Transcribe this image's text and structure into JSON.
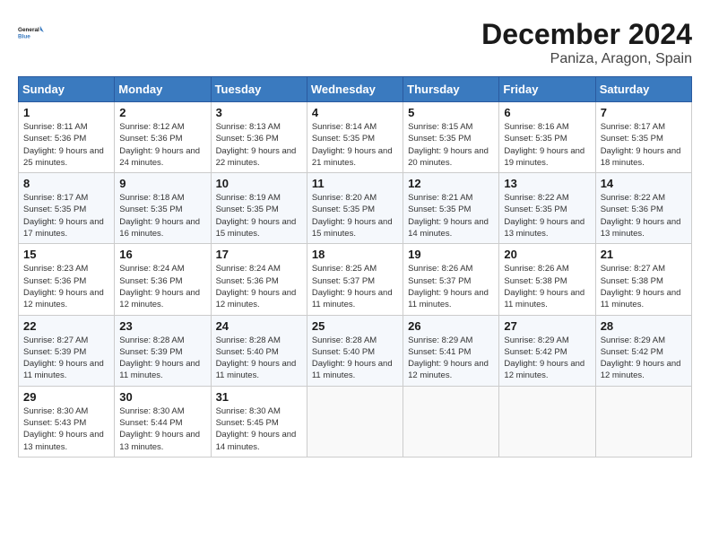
{
  "header": {
    "logo_line1": "General",
    "logo_line2": "Blue",
    "title": "December 2024",
    "subtitle": "Paniza, Aragon, Spain"
  },
  "weekdays": [
    "Sunday",
    "Monday",
    "Tuesday",
    "Wednesday",
    "Thursday",
    "Friday",
    "Saturday"
  ],
  "weeks": [
    [
      {
        "day": "1",
        "sunrise": "8:11 AM",
        "sunset": "5:36 PM",
        "daylight": "9 hours and 25 minutes."
      },
      {
        "day": "2",
        "sunrise": "8:12 AM",
        "sunset": "5:36 PM",
        "daylight": "9 hours and 24 minutes."
      },
      {
        "day": "3",
        "sunrise": "8:13 AM",
        "sunset": "5:36 PM",
        "daylight": "9 hours and 22 minutes."
      },
      {
        "day": "4",
        "sunrise": "8:14 AM",
        "sunset": "5:35 PM",
        "daylight": "9 hours and 21 minutes."
      },
      {
        "day": "5",
        "sunrise": "8:15 AM",
        "sunset": "5:35 PM",
        "daylight": "9 hours and 20 minutes."
      },
      {
        "day": "6",
        "sunrise": "8:16 AM",
        "sunset": "5:35 PM",
        "daylight": "9 hours and 19 minutes."
      },
      {
        "day": "7",
        "sunrise": "8:17 AM",
        "sunset": "5:35 PM",
        "daylight": "9 hours and 18 minutes."
      }
    ],
    [
      {
        "day": "8",
        "sunrise": "8:17 AM",
        "sunset": "5:35 PM",
        "daylight": "9 hours and 17 minutes."
      },
      {
        "day": "9",
        "sunrise": "8:18 AM",
        "sunset": "5:35 PM",
        "daylight": "9 hours and 16 minutes."
      },
      {
        "day": "10",
        "sunrise": "8:19 AM",
        "sunset": "5:35 PM",
        "daylight": "9 hours and 15 minutes."
      },
      {
        "day": "11",
        "sunrise": "8:20 AM",
        "sunset": "5:35 PM",
        "daylight": "9 hours and 15 minutes."
      },
      {
        "day": "12",
        "sunrise": "8:21 AM",
        "sunset": "5:35 PM",
        "daylight": "9 hours and 14 minutes."
      },
      {
        "day": "13",
        "sunrise": "8:22 AM",
        "sunset": "5:35 PM",
        "daylight": "9 hours and 13 minutes."
      },
      {
        "day": "14",
        "sunrise": "8:22 AM",
        "sunset": "5:36 PM",
        "daylight": "9 hours and 13 minutes."
      }
    ],
    [
      {
        "day": "15",
        "sunrise": "8:23 AM",
        "sunset": "5:36 PM",
        "daylight": "9 hours and 12 minutes."
      },
      {
        "day": "16",
        "sunrise": "8:24 AM",
        "sunset": "5:36 PM",
        "daylight": "9 hours and 12 minutes."
      },
      {
        "day": "17",
        "sunrise": "8:24 AM",
        "sunset": "5:36 PM",
        "daylight": "9 hours and 12 minutes."
      },
      {
        "day": "18",
        "sunrise": "8:25 AM",
        "sunset": "5:37 PM",
        "daylight": "9 hours and 11 minutes."
      },
      {
        "day": "19",
        "sunrise": "8:26 AM",
        "sunset": "5:37 PM",
        "daylight": "9 hours and 11 minutes."
      },
      {
        "day": "20",
        "sunrise": "8:26 AM",
        "sunset": "5:38 PM",
        "daylight": "9 hours and 11 minutes."
      },
      {
        "day": "21",
        "sunrise": "8:27 AM",
        "sunset": "5:38 PM",
        "daylight": "9 hours and 11 minutes."
      }
    ],
    [
      {
        "day": "22",
        "sunrise": "8:27 AM",
        "sunset": "5:39 PM",
        "daylight": "9 hours and 11 minutes."
      },
      {
        "day": "23",
        "sunrise": "8:28 AM",
        "sunset": "5:39 PM",
        "daylight": "9 hours and 11 minutes."
      },
      {
        "day": "24",
        "sunrise": "8:28 AM",
        "sunset": "5:40 PM",
        "daylight": "9 hours and 11 minutes."
      },
      {
        "day": "25",
        "sunrise": "8:28 AM",
        "sunset": "5:40 PM",
        "daylight": "9 hours and 11 minutes."
      },
      {
        "day": "26",
        "sunrise": "8:29 AM",
        "sunset": "5:41 PM",
        "daylight": "9 hours and 12 minutes."
      },
      {
        "day": "27",
        "sunrise": "8:29 AM",
        "sunset": "5:42 PM",
        "daylight": "9 hours and 12 minutes."
      },
      {
        "day": "28",
        "sunrise": "8:29 AM",
        "sunset": "5:42 PM",
        "daylight": "9 hours and 12 minutes."
      }
    ],
    [
      {
        "day": "29",
        "sunrise": "8:30 AM",
        "sunset": "5:43 PM",
        "daylight": "9 hours and 13 minutes."
      },
      {
        "day": "30",
        "sunrise": "8:30 AM",
        "sunset": "5:44 PM",
        "daylight": "9 hours and 13 minutes."
      },
      {
        "day": "31",
        "sunrise": "8:30 AM",
        "sunset": "5:45 PM",
        "daylight": "9 hours and 14 minutes."
      },
      null,
      null,
      null,
      null
    ]
  ]
}
